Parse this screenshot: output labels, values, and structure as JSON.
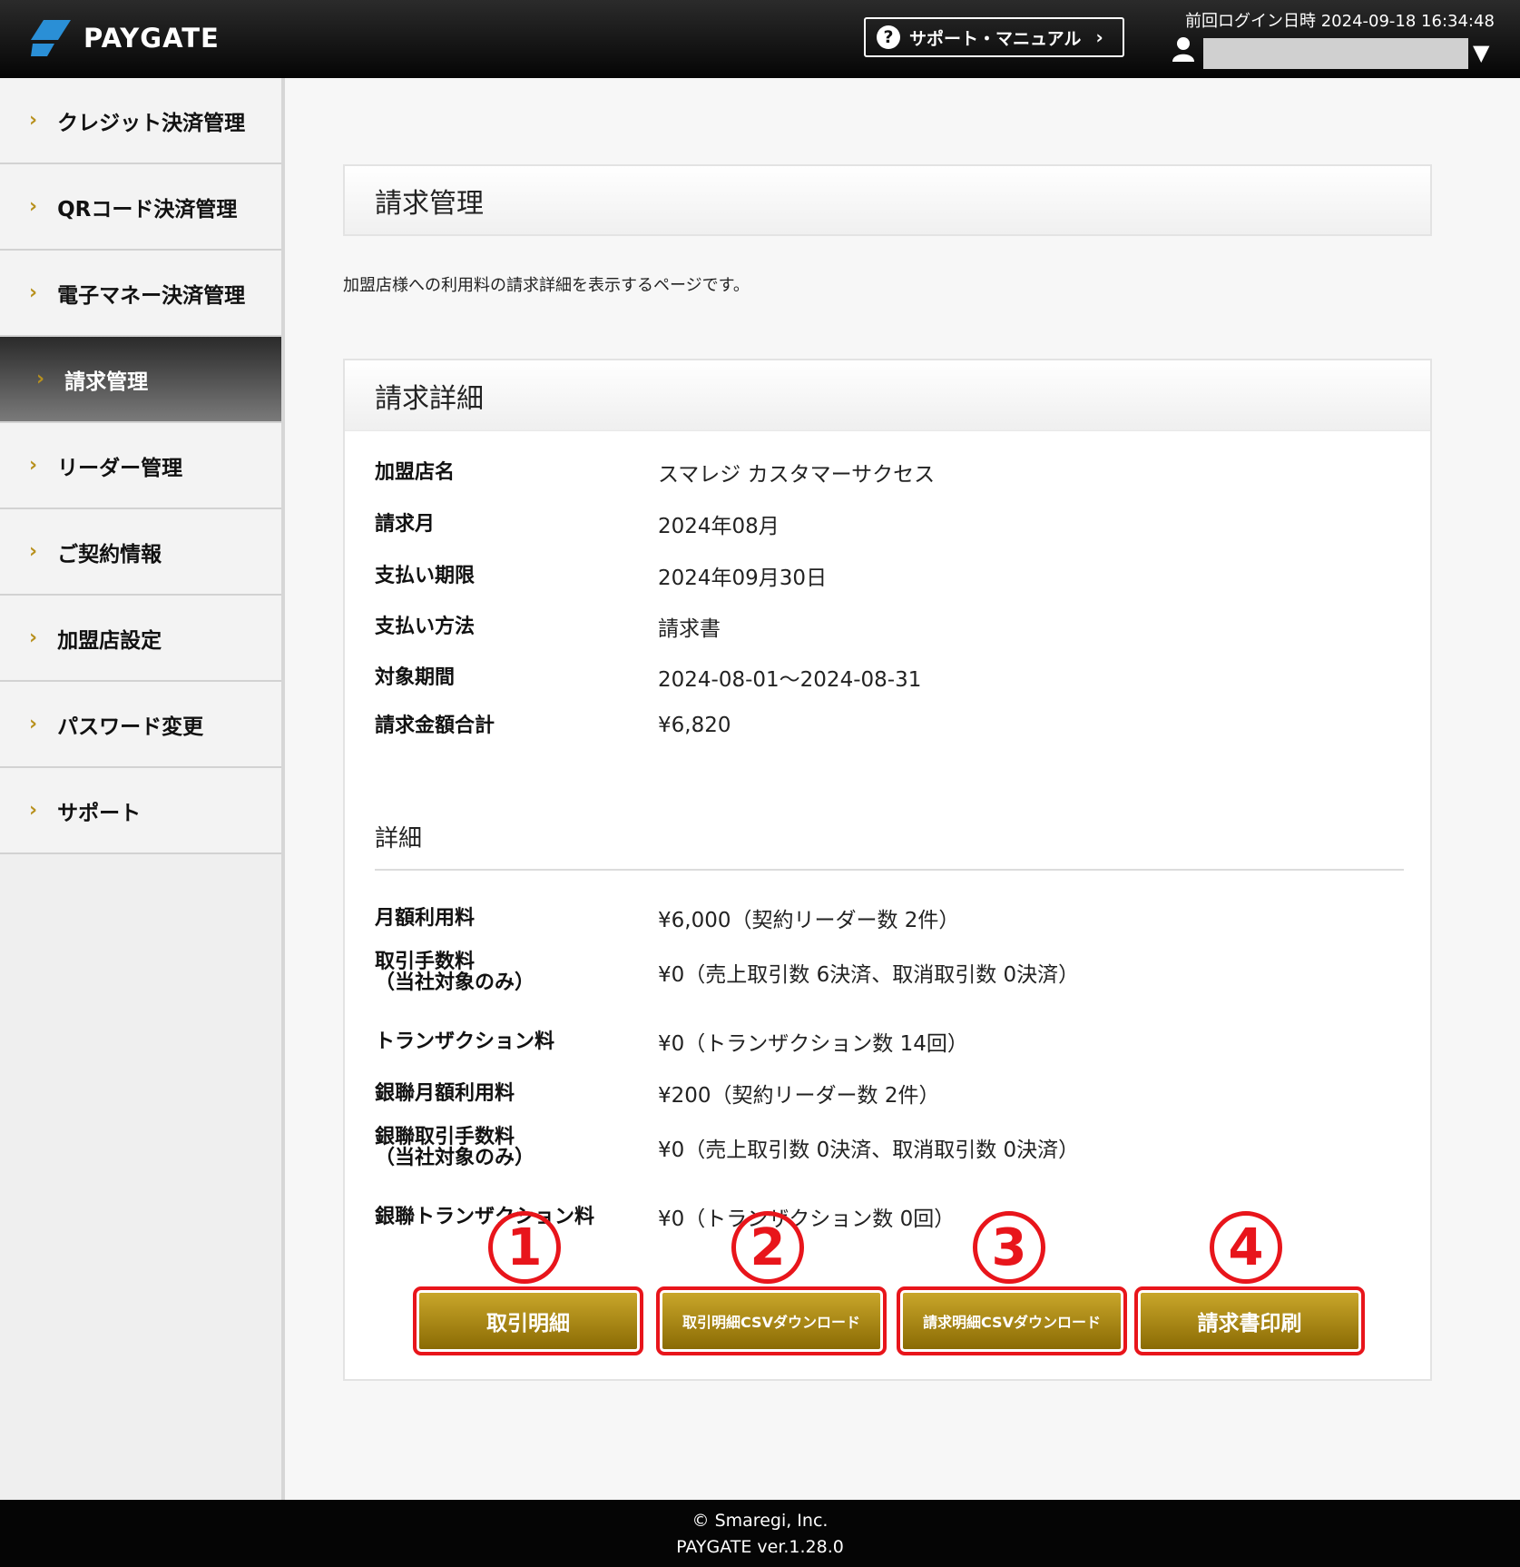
{
  "header": {
    "logo_text": "PAYGATE",
    "support_label": "サポート・マニュアル",
    "last_login": "前回ログイン日時 2024-09-18 16:34:48"
  },
  "sidebar": {
    "items": [
      {
        "label": "クレジット決済管理"
      },
      {
        "label": "QRコード決済管理"
      },
      {
        "label": "電子マネー決済管理"
      },
      {
        "label": "請求管理"
      },
      {
        "label": "リーダー管理"
      },
      {
        "label": "ご契約情報"
      },
      {
        "label": "加盟店設定"
      },
      {
        "label": "パスワード変更"
      },
      {
        "label": "サポート"
      }
    ]
  },
  "main": {
    "page_title": "請求管理",
    "description": "加盟店様への利用料の請求詳細を表示するページです。",
    "card_title": "請求詳細",
    "summary": [
      {
        "label": "加盟店名",
        "value": "スマレジ カスタマーサクセス"
      },
      {
        "label": "請求月",
        "value": "2024年08月"
      },
      {
        "label": "支払い期限",
        "value": "2024年09月30日"
      },
      {
        "label": "支払い方法",
        "value": "請求書"
      },
      {
        "label": "対象期間",
        "value": "2024-08-01〜2024-08-31"
      },
      {
        "label": "請求金額合計",
        "value": "¥6,820"
      }
    ],
    "detail_title": "詳細",
    "details": [
      {
        "label": "月額利用料",
        "value": "¥6,000（契約リーダー数 2件）"
      },
      {
        "label": "取引手数料\n（当社対象のみ）",
        "value": "¥0（売上取引数 6決済、取消取引数 0決済）"
      },
      {
        "label": "トランザクション料",
        "value": "¥0（トランザクション数 14回）"
      },
      {
        "label": "銀聯月額利用料",
        "value": "¥200（契約リーダー数 2件）"
      },
      {
        "label": "銀聯取引手数料\n（当社対象のみ）",
        "value": "¥0（売上取引数 0決済、取消取引数 0決済）"
      },
      {
        "label": "銀聯トランザクション料",
        "value": "¥0（トランザクション数 0回）"
      }
    ],
    "buttons": [
      {
        "label": "取引明細",
        "marker": "1"
      },
      {
        "label": "取引明細CSVダウンロード",
        "marker": "2"
      },
      {
        "label": "請求明細CSVダウンロード",
        "marker": "3"
      },
      {
        "label": "請求書印刷",
        "marker": "4"
      }
    ]
  },
  "footer": {
    "copyright": "© Smaregi, Inc.",
    "version": "PAYGATE ver.1.28.0"
  },
  "colors": {
    "accent_gold": "#b8911e",
    "annotation_red": "#e8151b",
    "logo_blue": "#2a8fd6"
  }
}
